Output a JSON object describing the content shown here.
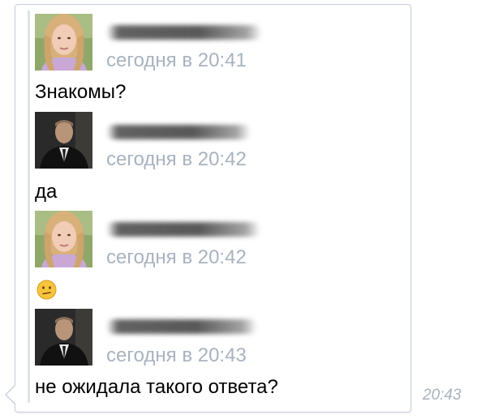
{
  "messages": [
    {
      "sender_avatar": "female-avatar",
      "time": "сегодня в 20:41",
      "text": "Знакомы?"
    },
    {
      "sender_avatar": "male-avatar",
      "time": "сегодня в 20:42",
      "text": "да"
    },
    {
      "sender_avatar": "female-avatar",
      "time": "сегодня в 20:42",
      "emoji": "confused-face-icon"
    },
    {
      "sender_avatar": "male-avatar",
      "time": "сегодня в 20:43",
      "text": "не ожидала такого ответа?"
    }
  ],
  "sent_time": "20:43",
  "colors": {
    "meta_text": "#a8b3bf",
    "bubble_border": "#c9d1da",
    "forward_bar": "#dde3ea"
  }
}
